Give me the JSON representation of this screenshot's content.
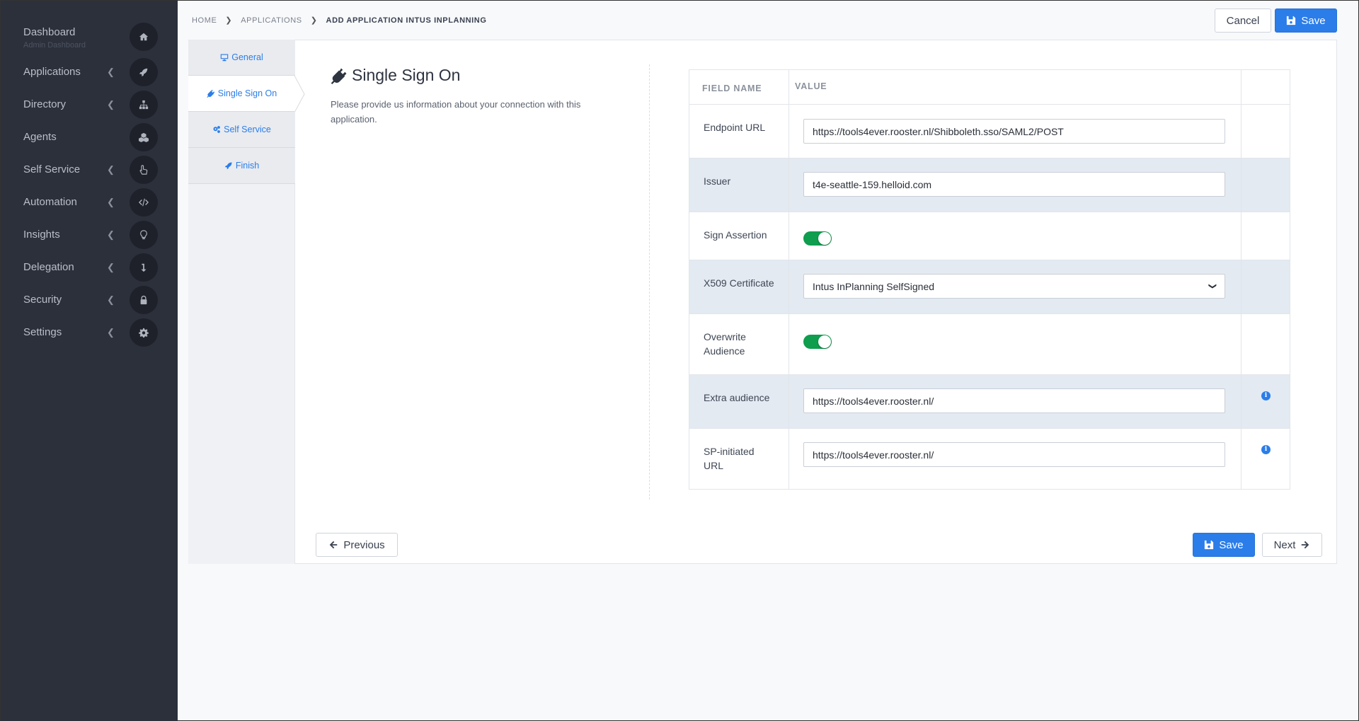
{
  "sidebar": {
    "dashboard": {
      "label": "Dashboard",
      "sub": "Admin Dashboard",
      "icon": "home-icon"
    },
    "items": [
      {
        "label": "Applications",
        "icon": "rocket-icon"
      },
      {
        "label": "Directory",
        "icon": "sitemap-icon"
      },
      {
        "label": "Agents",
        "icon": "cubes-icon"
      },
      {
        "label": "Self Service",
        "icon": "hand-pointer-icon"
      },
      {
        "label": "Automation",
        "icon": "code-icon"
      },
      {
        "label": "Insights",
        "icon": "lightbulb-icon"
      },
      {
        "label": "Delegation",
        "icon": "level-down-icon"
      },
      {
        "label": "Security",
        "icon": "lock-icon"
      },
      {
        "label": "Settings",
        "icon": "cog-icon"
      }
    ]
  },
  "breadcrumb": {
    "home": "HOME",
    "applications": "APPLICATIONS",
    "current": "ADD APPLICATION INTUS INPLANNING"
  },
  "header": {
    "cancel": "Cancel",
    "save": "Save"
  },
  "steps": [
    {
      "label": "General",
      "icon": "desktop-icon"
    },
    {
      "label": "Single Sign On",
      "icon": "plug-icon"
    },
    {
      "label": "Self Service",
      "icon": "cogs-icon"
    },
    {
      "label": "Finish",
      "icon": "rocket-icon"
    }
  ],
  "section": {
    "title": "Single Sign On",
    "description": "Please provide us information about your connection with this application."
  },
  "table": {
    "col_field": "FIELD NAME",
    "col_value": "VALUE",
    "endpoint_url": {
      "label": "Endpoint URL",
      "value": "https://tools4ever.rooster.nl/Shibboleth.sso/SAML2/POST"
    },
    "issuer": {
      "label": "Issuer",
      "value": "t4e-seattle-159.helloid.com"
    },
    "sign_assertion": {
      "label": "Sign Assertion",
      "checked": true
    },
    "x509": {
      "label": "X509 Certificate",
      "selected": "Intus InPlanning SelfSigned"
    },
    "overwrite_audience": {
      "label": "Overwrite Audience",
      "checked": true
    },
    "extra_audience": {
      "label": "Extra audience",
      "value": "https://tools4ever.rooster.nl/"
    },
    "sp_initiated": {
      "label": "SP-initiated URL",
      "value": "https://tools4ever.rooster.nl/"
    }
  },
  "footer": {
    "previous": "Previous",
    "save": "Save",
    "next": "Next"
  },
  "colors": {
    "primary": "#2b7de9",
    "sidebar": "#2c303b",
    "toggle_on": "#0f9d4e",
    "row_alt": "#e3eaf2"
  }
}
